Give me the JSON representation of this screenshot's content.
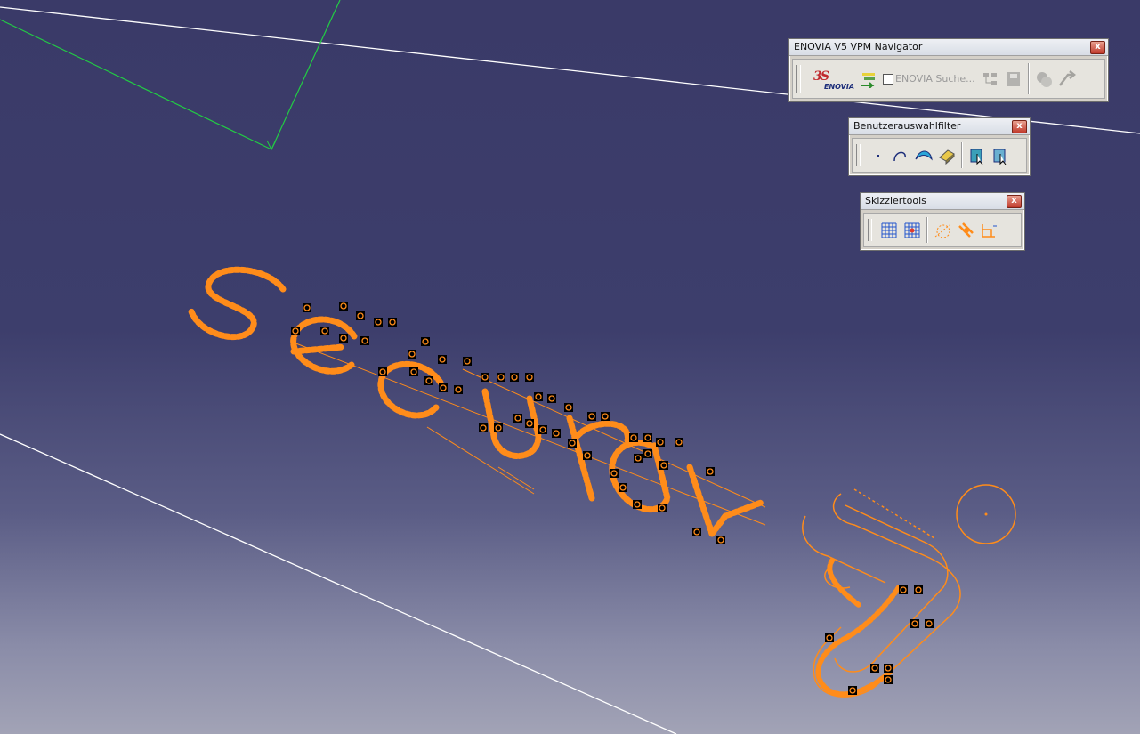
{
  "toolbars": {
    "navigator": {
      "title": "ENOVIA V5 VPM Navigator",
      "close": "x",
      "search_text": "ENOVIA Suche..."
    },
    "filter": {
      "title": "Benutzerauswahlfilter",
      "close": "x"
    },
    "sketch": {
      "title": "Skizziertools",
      "close": "x"
    }
  },
  "colors": {
    "sketch_geometry": "#ff8c1a",
    "construction_line": "#ffffff",
    "axis_line": "#22cc44",
    "constraint_marker": "#000000"
  },
  "icons": {
    "navigator": [
      "ds-enovia-logo-icon",
      "navigator-arrow-icon",
      "search-checkbox",
      "tree-icon",
      "save-icon",
      "sync-icon",
      "refresh-icon"
    ],
    "filter": [
      "point-filter-icon",
      "curve-filter-icon",
      "surface-filter-icon",
      "volume-filter-icon",
      "feature-filter-icon",
      "selection-filter-icon"
    ],
    "sketch": [
      "grid-icon",
      "snap-grid-icon",
      "construction-icon",
      "geometric-constraint-icon",
      "dimensional-constraint-icon"
    ]
  }
}
